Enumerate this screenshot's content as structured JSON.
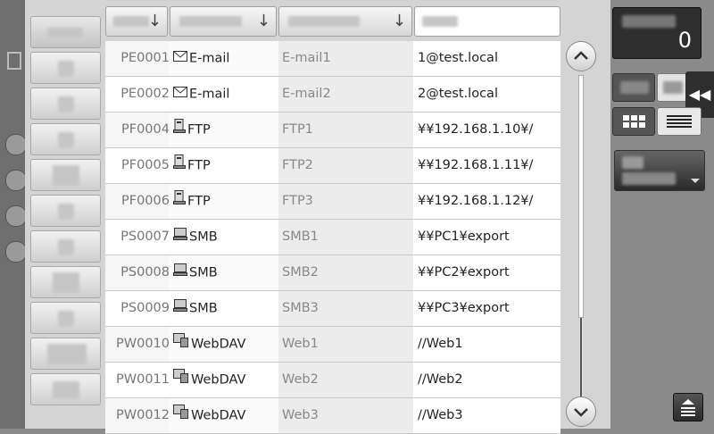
{
  "counter": {
    "value": "0"
  },
  "scroll": {
    "up_icon": "chevron-up-icon",
    "down_icon": "chevron-down-icon"
  },
  "collapse": {
    "label": "◀◀"
  },
  "rows": [
    {
      "no": "PE0001",
      "type": "E-mail",
      "icon": "mail-icon",
      "name": "E-mail1",
      "dest": "1@test.local"
    },
    {
      "no": "PE0002",
      "type": "E-mail",
      "icon": "mail-icon",
      "name": "E-mail2",
      "dest": "2@test.local"
    },
    {
      "no": "PF0004",
      "type": "FTP",
      "icon": "ftp-server-icon",
      "name": "FTP1",
      "dest": "¥¥192.168.1.10¥/"
    },
    {
      "no": "PF0005",
      "type": "FTP",
      "icon": "ftp-server-icon",
      "name": "FTP2",
      "dest": "¥¥192.168.1.11¥/"
    },
    {
      "no": "PF0006",
      "type": "FTP",
      "icon": "ftp-server-icon",
      "name": "FTP3",
      "dest": "¥¥192.168.1.12¥/"
    },
    {
      "no": "PS0007",
      "type": "SMB",
      "icon": "pc-icon",
      "name": "SMB1",
      "dest": "¥¥PC1¥export"
    },
    {
      "no": "PS0008",
      "type": "SMB",
      "icon": "pc-icon",
      "name": "SMB2",
      "dest": "¥¥PC2¥export"
    },
    {
      "no": "PS0009",
      "type": "SMB",
      "icon": "pc-icon",
      "name": "SMB3",
      "dest": "¥¥PC3¥export"
    },
    {
      "no": "PW0010",
      "type": "WebDAV",
      "icon": "webdav-icon",
      "name": "Web1",
      "dest": "//Web1"
    },
    {
      "no": "PW0011",
      "type": "WebDAV",
      "icon": "webdav-icon",
      "name": "Web2",
      "dest": "//Web2"
    },
    {
      "no": "PW0012",
      "type": "WebDAV",
      "icon": "webdav-icon",
      "name": "Web3",
      "dest": "//Web3"
    }
  ]
}
